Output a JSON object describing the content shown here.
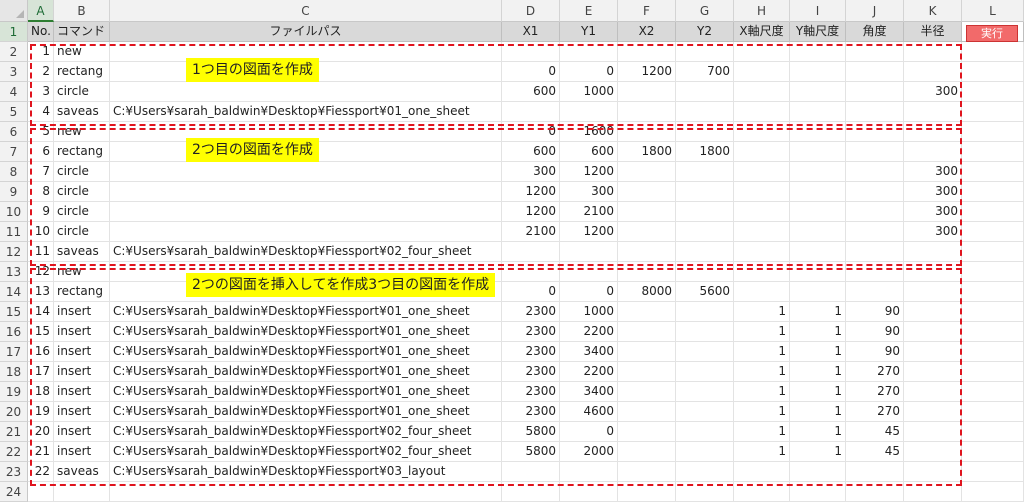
{
  "columns": [
    "A",
    "B",
    "C",
    "D",
    "E",
    "F",
    "G",
    "H",
    "I",
    "J",
    "K",
    "L"
  ],
  "selected_column": "A",
  "header": [
    "No.",
    "コマンド",
    "ファイルパス",
    "X1",
    "Y1",
    "X2",
    "Y2",
    "X軸尺度",
    "Y軸尺度",
    "角度",
    "半径"
  ],
  "run_button": "実行",
  "rows": [
    {
      "no": "1",
      "cmd": "new",
      "path": "",
      "x1": "",
      "y1": "",
      "x2": "",
      "y2": "",
      "xs": "",
      "ys": "",
      "ang": "",
      "r": ""
    },
    {
      "no": "2",
      "cmd": "rectang",
      "path": "",
      "x1": "0",
      "y1": "0",
      "x2": "1200",
      "y2": "700",
      "xs": "",
      "ys": "",
      "ang": "",
      "r": ""
    },
    {
      "no": "3",
      "cmd": "circle",
      "path": "",
      "x1": "600",
      "y1": "1000",
      "x2": "",
      "y2": "",
      "xs": "",
      "ys": "",
      "ang": "",
      "r": "300"
    },
    {
      "no": "4",
      "cmd": "saveas",
      "path": "C:¥Users¥sarah_baldwin¥Desktop¥Fiessport¥01_one_sheet",
      "x1": "",
      "y1": "",
      "x2": "",
      "y2": "",
      "xs": "",
      "ys": "",
      "ang": "",
      "r": ""
    },
    {
      "no": "5",
      "cmd": "new",
      "path": "",
      "x1": "0",
      "y1": "1600",
      "x2": "",
      "y2": "",
      "xs": "",
      "ys": "",
      "ang": "",
      "r": ""
    },
    {
      "no": "6",
      "cmd": "rectang",
      "path": "",
      "x1": "600",
      "y1": "600",
      "x2": "1800",
      "y2": "1800",
      "xs": "",
      "ys": "",
      "ang": "",
      "r": ""
    },
    {
      "no": "7",
      "cmd": "circle",
      "path": "",
      "x1": "300",
      "y1": "1200",
      "x2": "",
      "y2": "",
      "xs": "",
      "ys": "",
      "ang": "",
      "r": "300"
    },
    {
      "no": "8",
      "cmd": "circle",
      "path": "",
      "x1": "1200",
      "y1": "300",
      "x2": "",
      "y2": "",
      "xs": "",
      "ys": "",
      "ang": "",
      "r": "300"
    },
    {
      "no": "9",
      "cmd": "circle",
      "path": "",
      "x1": "1200",
      "y1": "2100",
      "x2": "",
      "y2": "",
      "xs": "",
      "ys": "",
      "ang": "",
      "r": "300"
    },
    {
      "no": "10",
      "cmd": "circle",
      "path": "",
      "x1": "2100",
      "y1": "1200",
      "x2": "",
      "y2": "",
      "xs": "",
      "ys": "",
      "ang": "",
      "r": "300"
    },
    {
      "no": "11",
      "cmd": "saveas",
      "path": "C:¥Users¥sarah_baldwin¥Desktop¥Fiessport¥02_four_sheet",
      "x1": "",
      "y1": "",
      "x2": "",
      "y2": "",
      "xs": "",
      "ys": "",
      "ang": "",
      "r": ""
    },
    {
      "no": "12",
      "cmd": "new",
      "path": "",
      "x1": "",
      "y1": "",
      "x2": "",
      "y2": "",
      "xs": "",
      "ys": "",
      "ang": "",
      "r": ""
    },
    {
      "no": "13",
      "cmd": "rectang",
      "path": "",
      "x1": "0",
      "y1": "0",
      "x2": "8000",
      "y2": "5600",
      "xs": "",
      "ys": "",
      "ang": "",
      "r": ""
    },
    {
      "no": "14",
      "cmd": "insert",
      "path": "C:¥Users¥sarah_baldwin¥Desktop¥Fiessport¥01_one_sheet",
      "x1": "2300",
      "y1": "1000",
      "x2": "",
      "y2": "",
      "xs": "1",
      "ys": "1",
      "ang": "90",
      "r": ""
    },
    {
      "no": "15",
      "cmd": "insert",
      "path": "C:¥Users¥sarah_baldwin¥Desktop¥Fiessport¥01_one_sheet",
      "x1": "2300",
      "y1": "2200",
      "x2": "",
      "y2": "",
      "xs": "1",
      "ys": "1",
      "ang": "90",
      "r": ""
    },
    {
      "no": "16",
      "cmd": "insert",
      "path": "C:¥Users¥sarah_baldwin¥Desktop¥Fiessport¥01_one_sheet",
      "x1": "2300",
      "y1": "3400",
      "x2": "",
      "y2": "",
      "xs": "1",
      "ys": "1",
      "ang": "90",
      "r": ""
    },
    {
      "no": "17",
      "cmd": "insert",
      "path": "C:¥Users¥sarah_baldwin¥Desktop¥Fiessport¥01_one_sheet",
      "x1": "2300",
      "y1": "2200",
      "x2": "",
      "y2": "",
      "xs": "1",
      "ys": "1",
      "ang": "270",
      "r": ""
    },
    {
      "no": "18",
      "cmd": "insert",
      "path": "C:¥Users¥sarah_baldwin¥Desktop¥Fiessport¥01_one_sheet",
      "x1": "2300",
      "y1": "3400",
      "x2": "",
      "y2": "",
      "xs": "1",
      "ys": "1",
      "ang": "270",
      "r": ""
    },
    {
      "no": "19",
      "cmd": "insert",
      "path": "C:¥Users¥sarah_baldwin¥Desktop¥Fiessport¥01_one_sheet",
      "x1": "2300",
      "y1": "4600",
      "x2": "",
      "y2": "",
      "xs": "1",
      "ys": "1",
      "ang": "270",
      "r": ""
    },
    {
      "no": "20",
      "cmd": "insert",
      "path": "C:¥Users¥sarah_baldwin¥Desktop¥Fiessport¥02_four_sheet",
      "x1": "5800",
      "y1": "0",
      "x2": "",
      "y2": "",
      "xs": "1",
      "ys": "1",
      "ang": "45",
      "r": ""
    },
    {
      "no": "21",
      "cmd": "insert",
      "path": "C:¥Users¥sarah_baldwin¥Desktop¥Fiessport¥02_four_sheet",
      "x1": "5800",
      "y1": "2000",
      "x2": "",
      "y2": "",
      "xs": "1",
      "ys": "1",
      "ang": "45",
      "r": ""
    },
    {
      "no": "22",
      "cmd": "saveas",
      "path": "C:¥Users¥sarah_baldwin¥Desktop¥Fiessport¥03_layout",
      "x1": "",
      "y1": "",
      "x2": "",
      "y2": "",
      "xs": "",
      "ys": "",
      "ang": "",
      "r": ""
    }
  ],
  "annotations": [
    {
      "text": "1つ目の図面を作成"
    },
    {
      "text": "2つ目の図面を作成"
    },
    {
      "text": "2つの図面を挿入してを作成3つ目の図面を作成"
    }
  ],
  "colors": {
    "highlight": "#ffff00",
    "dash": "#e0141e",
    "run_button": "#f26a6a",
    "header_fill": "#d9d9d9"
  }
}
